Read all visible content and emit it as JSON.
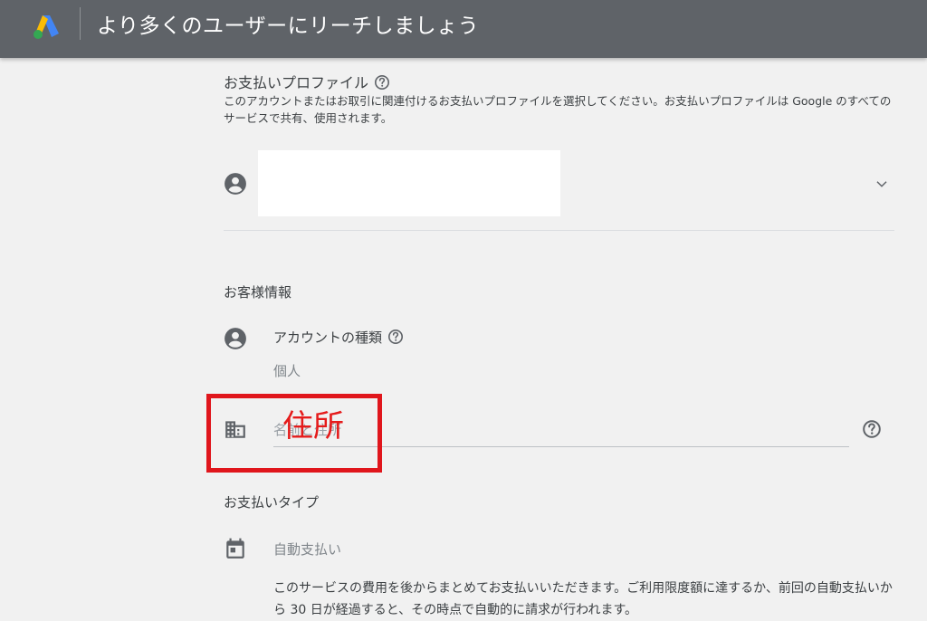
{
  "header": {
    "title": "より多くのユーザーにリーチしましょう",
    "logo_icon": "google-ads-logo"
  },
  "payment_profile": {
    "title": "お支払いプロファイル",
    "description": "このアカウントまたはお取引に関連付けるお支払いプロファイルを選択してください。お支払いプロファイルは Google のすべてのサービスで共有、使用されます。",
    "selected_value": ""
  },
  "customer_info": {
    "section_title": "お客様情報",
    "account_type_label": "アカウントの種類",
    "account_type_value": "個人",
    "address_placeholder": "名前と住所"
  },
  "annotation": {
    "label": "住所",
    "color": "#e0161c"
  },
  "payment_type": {
    "section_title": "お支払いタイプ",
    "value": "自動支払い",
    "description": "このサービスの費用を後からまとめてお支払いいただきます。ご利用限度額に達するか、前回の自動支払いから 30 日が経過すると、その時点で自動的に請求が行われます。"
  },
  "colors": {
    "header_bg": "#5f6368",
    "page_bg": "#f1f1f1",
    "annotation_red": "#e0161c"
  }
}
